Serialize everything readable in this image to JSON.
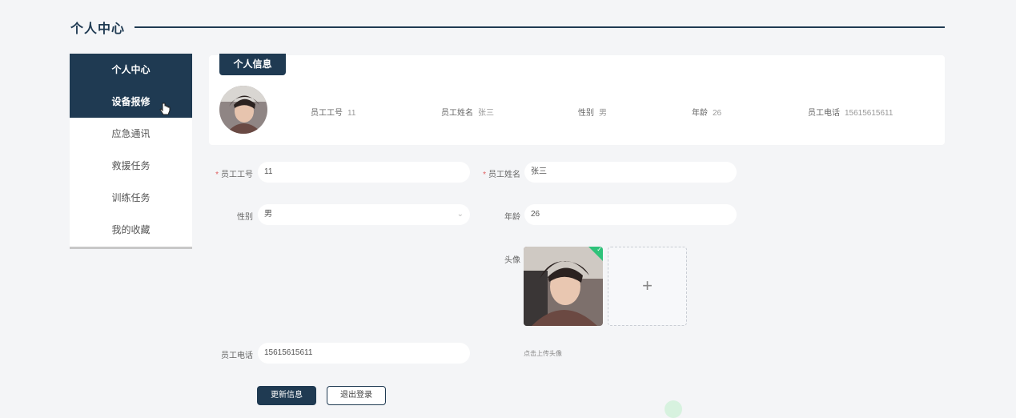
{
  "page": {
    "title": "个人中心"
  },
  "sidebar": {
    "items": [
      {
        "label": "个人中心",
        "active": true
      },
      {
        "label": "设备报修",
        "active": true
      },
      {
        "label": "应急通讯",
        "active": false
      },
      {
        "label": "救援任务",
        "active": false
      },
      {
        "label": "训练任务",
        "active": false
      },
      {
        "label": "我的收藏",
        "active": false
      }
    ]
  },
  "info_card": {
    "tab_label": "个人信息",
    "fields": [
      {
        "label": "员工工号",
        "value": "11"
      },
      {
        "label": "员工姓名",
        "value": "张三"
      },
      {
        "label": "性别",
        "value": "男"
      },
      {
        "label": "年龄",
        "value": "26"
      },
      {
        "label": "员工电话",
        "value": "15615615611"
      }
    ]
  },
  "form": {
    "emp_id": {
      "label": "员工工号",
      "value": "11",
      "required": true
    },
    "emp_name": {
      "label": "员工姓名",
      "value": "张三",
      "required": true
    },
    "gender": {
      "label": "性别",
      "value": "男"
    },
    "age": {
      "label": "年龄",
      "value": "26"
    },
    "avatar": {
      "label": "头像",
      "upload_hint": "点击上传头像",
      "plus": "+"
    },
    "phone": {
      "label": "员工电话",
      "value": "15615615611"
    },
    "required_mark": "*"
  },
  "buttons": {
    "update": "更新信息",
    "logout": "退出登录"
  },
  "colors": {
    "primary": "#1f3a52",
    "success": "#2fc27a",
    "background": "#f4f5f7"
  }
}
